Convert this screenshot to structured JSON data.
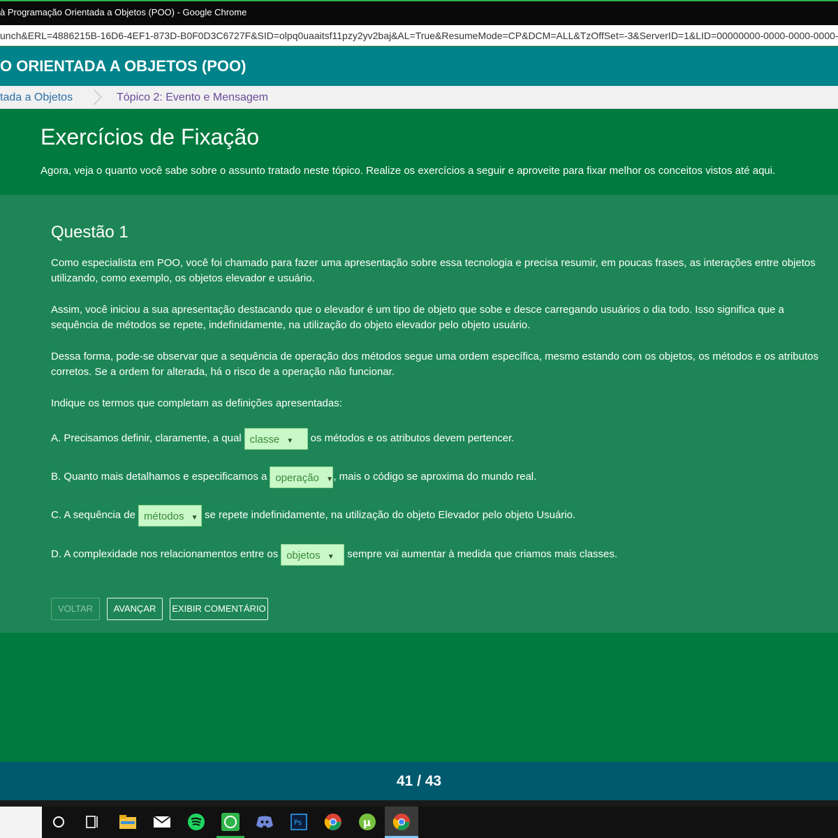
{
  "window": {
    "title": "à Programação Orientada a Objetos (POO) - Google Chrome"
  },
  "address_bar": {
    "url": "unch&ERL=4886215B-16D6-4EF1-873D-B0F0D3C6727F&SID=olpq0uaaitsf11pzy2yv2baj&AL=True&ResumeMode=CP&DCM=ALL&TzOffSet=-3&ServerID=1&LID=00000000-0000-0000-0000-00"
  },
  "course_header": {
    "title": "O ORIENTADA A OBJETOS (POO)"
  },
  "breadcrumb": {
    "items": [
      "tada a Objetos",
      "Tópico 2: Evento e Mensagem"
    ]
  },
  "intro": {
    "heading": "Exercícios de Fixação",
    "text": "Agora, veja o quanto você sabe sobre o assunto tratado neste tópico. Realize os exercícios a seguir e aproveite para fixar melhor os conceitos vistos até aqui."
  },
  "question": {
    "title": "Questão 1",
    "paragraphs": [
      "Como especialista em POO, você foi chamado para fazer uma apresentação sobre essa tecnologia e precisa resumir, em poucas frases, as interações entre objetos utilizando, como exemplo, os objetos elevador e usuário.",
      "Assim, você iniciou a sua apresentação destacando que o elevador é um tipo de objeto que sobe e desce carregando usuários o dia todo. Isso significa que a sequência de métodos se repete, indefinidamente, na utilização do objeto elevador pelo objeto usuário.",
      "Dessa forma, pode-se observar que a sequência de operação dos métodos segue uma ordem específica, mesmo estando com os objetos, os métodos e os atributos corretos. Se a ordem for alterada, há o risco de a operação não funcionar.",
      "Indique os termos que completam as definições apresentadas:"
    ],
    "items": [
      {
        "before": "A. Precisamos definir, claramente, a qual",
        "selected": "classe",
        "after": "os métodos e os atributos devem pertencer."
      },
      {
        "before": "B. Quanto mais detalhamos e especificamos a",
        "selected": "operação",
        "after": ", mais o código se aproxima do mundo real."
      },
      {
        "before": "C. A sequência de",
        "selected": "métodos",
        "after": "se repete indefinidamente, na utilização do objeto Elevador pelo objeto Usuário."
      },
      {
        "before": "D. A complexidade nos relacionamentos entre os",
        "selected": "objetos",
        "after": "sempre vai aumentar à medida que criamos mais classes."
      }
    ],
    "buttons": {
      "back": "VOLTAR",
      "next": "AVANÇAR",
      "comment": "EXIBIR COMENTÁRIO"
    }
  },
  "pager": {
    "text": "41 / 43"
  },
  "taskbar": {
    "icons": [
      "cortana-icon",
      "task-view-icon",
      "file-explorer-icon",
      "mail-icon",
      "spotify-icon",
      "whatsapp-icon",
      "discord-icon",
      "photoshop-icon",
      "chrome-icon",
      "utorrent-icon",
      "chrome-icon"
    ]
  },
  "colors": {
    "course_header": "#00838a",
    "content_green": "#007a3e",
    "question_panel": "#1e8656",
    "pager_bar": "#005a6e",
    "dropdown_bg": "#c8f7c8"
  }
}
